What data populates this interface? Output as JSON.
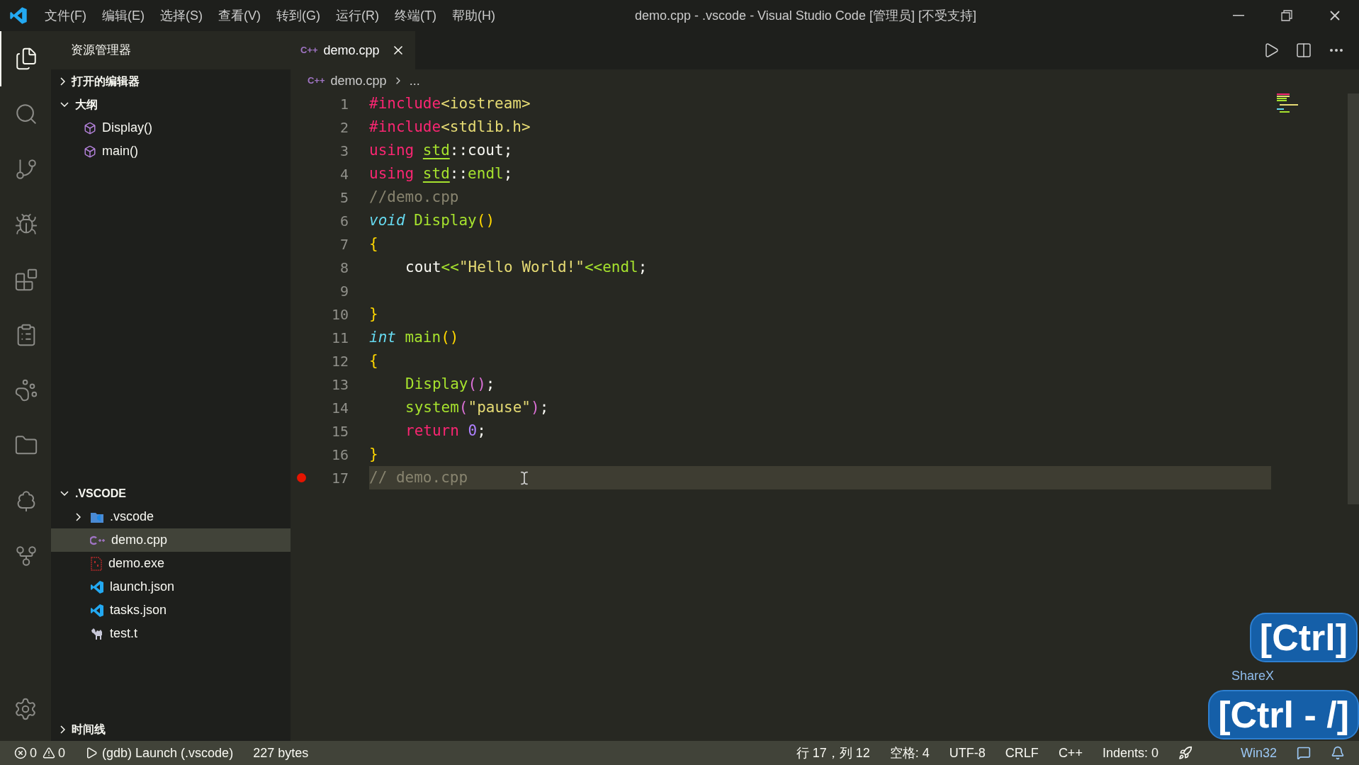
{
  "window": {
    "title": "demo.cpp - .vscode - Visual Studio Code [管理员] [不受支持]",
    "menu": [
      "文件(F)",
      "编辑(E)",
      "选择(S)",
      "查看(V)",
      "转到(G)",
      "运行(R)",
      "终端(T)",
      "帮助(H)"
    ]
  },
  "activity_bar": [
    {
      "kind": "files",
      "selected": true
    },
    {
      "kind": "search",
      "selected": false
    },
    {
      "kind": "branch",
      "selected": false
    },
    {
      "kind": "debug",
      "selected": false
    },
    {
      "kind": "extensions",
      "selected": false
    },
    {
      "kind": "clipboard",
      "selected": false
    },
    {
      "kind": "paw",
      "selected": false
    },
    {
      "kind": "folder",
      "selected": false
    },
    {
      "kind": "tree",
      "selected": false
    },
    {
      "kind": "graph",
      "selected": false
    }
  ],
  "sidebar": {
    "title": "资源管理器",
    "sections": [
      {
        "label": "打开的编辑器",
        "expanded": false
      },
      {
        "label": "大纲",
        "expanded": true,
        "items": [
          {
            "label": "Display()",
            "kind": "symbol",
            "selected": false
          },
          {
            "label": "main()",
            "kind": "symbol",
            "selected": false
          }
        ]
      },
      {
        "label": ".VSCODE",
        "expanded": true,
        "items": [
          {
            "label": ".vscode",
            "kind": "folder",
            "expanded": false,
            "selected": false
          },
          {
            "label": "demo.cpp",
            "kind": "cpp",
            "selected": true
          },
          {
            "label": "demo.exe",
            "kind": "binary",
            "selected": false
          },
          {
            "label": "launch.json",
            "kind": "vscode",
            "selected": false
          },
          {
            "label": "tasks.json",
            "kind": "vscode",
            "selected": false
          },
          {
            "label": "test.t",
            "kind": "camel",
            "selected": false
          }
        ]
      },
      {
        "label": "时间线",
        "expanded": false
      }
    ]
  },
  "tabs": [
    {
      "label": "demo.cpp",
      "icon": "C++",
      "selected": true
    }
  ],
  "breadcrumb": {
    "icon": "C++",
    "file": "demo.cpp",
    "rest": "..."
  },
  "editor": {
    "lines": [
      {
        "number": "1",
        "indent": false,
        "tokens": [
          {
            "kind": "directive",
            "s": "#include"
          },
          {
            "kind": "string",
            "s": "<iostream>"
          }
        ]
      },
      {
        "number": "2",
        "indent": false,
        "tokens": [
          {
            "kind": "directive",
            "s": "#include"
          },
          {
            "kind": "string",
            "s": "<stdlib.h>"
          }
        ]
      },
      {
        "number": "3",
        "indent": false,
        "tokens": [
          {
            "kind": "keyword",
            "s": "using "
          },
          {
            "kind": "namespace",
            "s": "std"
          },
          {
            "kind": "plain",
            "s": "::cout;"
          }
        ]
      },
      {
        "number": "4",
        "indent": false,
        "tokens": [
          {
            "kind": "keyword",
            "s": "using "
          },
          {
            "kind": "namespace",
            "s": "std"
          },
          {
            "kind": "plain",
            "s": "::"
          },
          {
            "kind": "function",
            "s": "endl"
          },
          {
            "kind": "plain",
            "s": ";"
          }
        ]
      },
      {
        "number": "5",
        "indent": false,
        "tokens": [
          {
            "kind": "comment",
            "s": "//demo.cpp"
          }
        ]
      },
      {
        "number": "6",
        "indent": false,
        "tokens": [
          {
            "kind": "storage",
            "s": "void "
          },
          {
            "kind": "function",
            "s": "Display"
          },
          {
            "kind": "brace",
            "s": "()"
          }
        ]
      },
      {
        "number": "7",
        "indent": false,
        "tokens": [
          {
            "kind": "brace",
            "s": "{"
          }
        ]
      },
      {
        "number": "8",
        "indent": true,
        "tokens": [
          {
            "kind": "plain",
            "s": "cout"
          },
          {
            "kind": "function",
            "s": "<<"
          },
          {
            "kind": "string",
            "s": "\"Hello World!\""
          },
          {
            "kind": "function",
            "s": "<<endl"
          },
          {
            "kind": "plain",
            "s": ";"
          }
        ]
      },
      {
        "number": "9"
      },
      {
        "number": "10",
        "indent": false,
        "tokens": [
          {
            "kind": "brace",
            "s": "}"
          }
        ]
      },
      {
        "number": "11",
        "indent": false,
        "tokens": [
          {
            "kind": "storage",
            "s": "int "
          },
          {
            "kind": "function",
            "s": "main"
          },
          {
            "kind": "brace",
            "s": "()"
          }
        ]
      },
      {
        "number": "12",
        "indent": false,
        "tokens": [
          {
            "kind": "brace",
            "s": "{"
          }
        ]
      },
      {
        "number": "13",
        "indent": true,
        "tokens": [
          {
            "kind": "function",
            "s": "Display"
          },
          {
            "kind": "paren",
            "s": "()"
          },
          {
            "kind": "plain",
            "s": ";"
          }
        ]
      },
      {
        "number": "14",
        "indent": true,
        "tokens": [
          {
            "kind": "function",
            "s": "system"
          },
          {
            "kind": "paren",
            "s": "("
          },
          {
            "kind": "string",
            "s": "\"pause\""
          },
          {
            "kind": "paren",
            "s": ")"
          },
          {
            "kind": "plain",
            "s": ";"
          }
        ]
      },
      {
        "number": "15",
        "indent": true,
        "tokens": [
          {
            "kind": "keyword",
            "s": "return "
          },
          {
            "kind": "number",
            "s": "0"
          },
          {
            "kind": "plain",
            "s": ";"
          }
        ]
      },
      {
        "number": "16",
        "indent": false,
        "tokens": [
          {
            "kind": "brace",
            "s": "}"
          }
        ]
      },
      {
        "number": "17",
        "breakpoint": true,
        "current": true,
        "indent": false,
        "tokens": [
          {
            "kind": "comment",
            "s": "// demo.cpp"
          }
        ]
      }
    ]
  },
  "status_bar": {
    "errors": "0",
    "warnings": "0",
    "launch": "(gdb) Launch (.vscode)",
    "size": "227 bytes",
    "right": [
      "行 17，列 12",
      "空格: 4",
      "UTF-8",
      "CRLF",
      "C++",
      "Indents: 0"
    ],
    "platform": "Win32"
  },
  "sharex": {
    "label": "ShareX"
  },
  "keystrokes": [
    "[Ctrl]",
    "[Ctrl - /]"
  ]
}
